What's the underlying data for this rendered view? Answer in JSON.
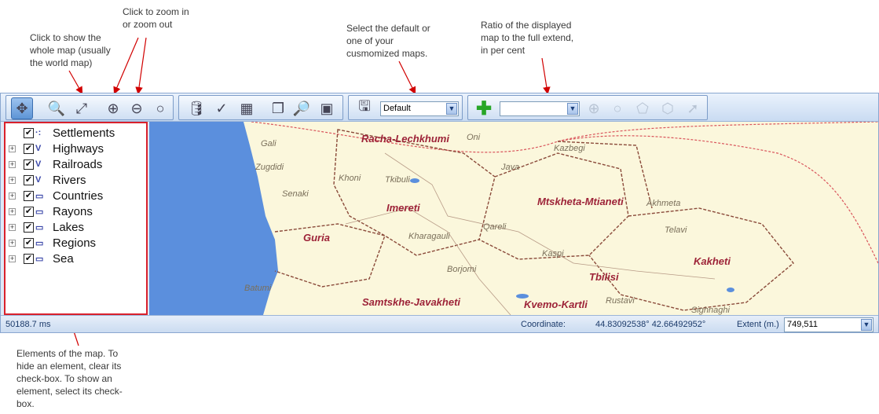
{
  "annotations": {
    "whole_map": "Click to show the\nwhole map (usually\nthe world map)",
    "zoom": "Click to zoom in\nor zoom out",
    "select_map": "Select the default or\none of your\ncusmomized maps.",
    "ratio": "Ratio of the displayed\nmap to the full extend,\nin per cent",
    "elements": "Elements of the map. To\nhide an element, clear its\ncheck-box. To show an\nelement, select its check-\nbox."
  },
  "toolbar": {
    "map_select_value": "Default",
    "ratio_select_value": ""
  },
  "layers": [
    {
      "label": "Settlements",
      "expandable": false,
      "checked": true,
      "icon": "point-layer-icon"
    },
    {
      "label": "Highways",
      "expandable": true,
      "checked": true,
      "icon": "line-layer-icon"
    },
    {
      "label": "Railroads",
      "expandable": true,
      "checked": true,
      "icon": "line-layer-icon"
    },
    {
      "label": "Rivers",
      "expandable": true,
      "checked": true,
      "icon": "line-layer-icon"
    },
    {
      "label": "Countries",
      "expandable": true,
      "checked": true,
      "icon": "polygon-layer-icon"
    },
    {
      "label": "Rayons",
      "expandable": true,
      "checked": true,
      "icon": "polygon-layer-icon"
    },
    {
      "label": "Lakes",
      "expandable": true,
      "checked": true,
      "icon": "polygon-layer-icon"
    },
    {
      "label": "Regions",
      "expandable": true,
      "checked": true,
      "icon": "polygon-layer-icon"
    },
    {
      "label": "Sea",
      "expandable": true,
      "checked": true,
      "icon": "polygon-layer-icon"
    }
  ],
  "map": {
    "regions": [
      "Racha-Lechkhumi",
      "Imereti",
      "Mtskheta-Mtianeti",
      "Guria",
      "Kakheti",
      "Tbilisi",
      "Samtskhe-Javakheti",
      "Kvemo-Kartli"
    ],
    "places": [
      "Gali",
      "Oni",
      "Kazbegi",
      "Zugdidi",
      "Java",
      "Khoni",
      "Tkibuli",
      "Senaki",
      "Akhmeta",
      "Telavi",
      "Kharagauli",
      "Qareli",
      "Kaspi",
      "Borjomi",
      "Batumi",
      "Rustavi",
      "Sighnaghi"
    ]
  },
  "status": {
    "time": "50188.7 ms",
    "coordinate_label": "Coordinate:",
    "coordinate_value": "44.83092538° 42.66492952°",
    "extent_label": "Extent (m.)",
    "extent_value": "749,511"
  }
}
